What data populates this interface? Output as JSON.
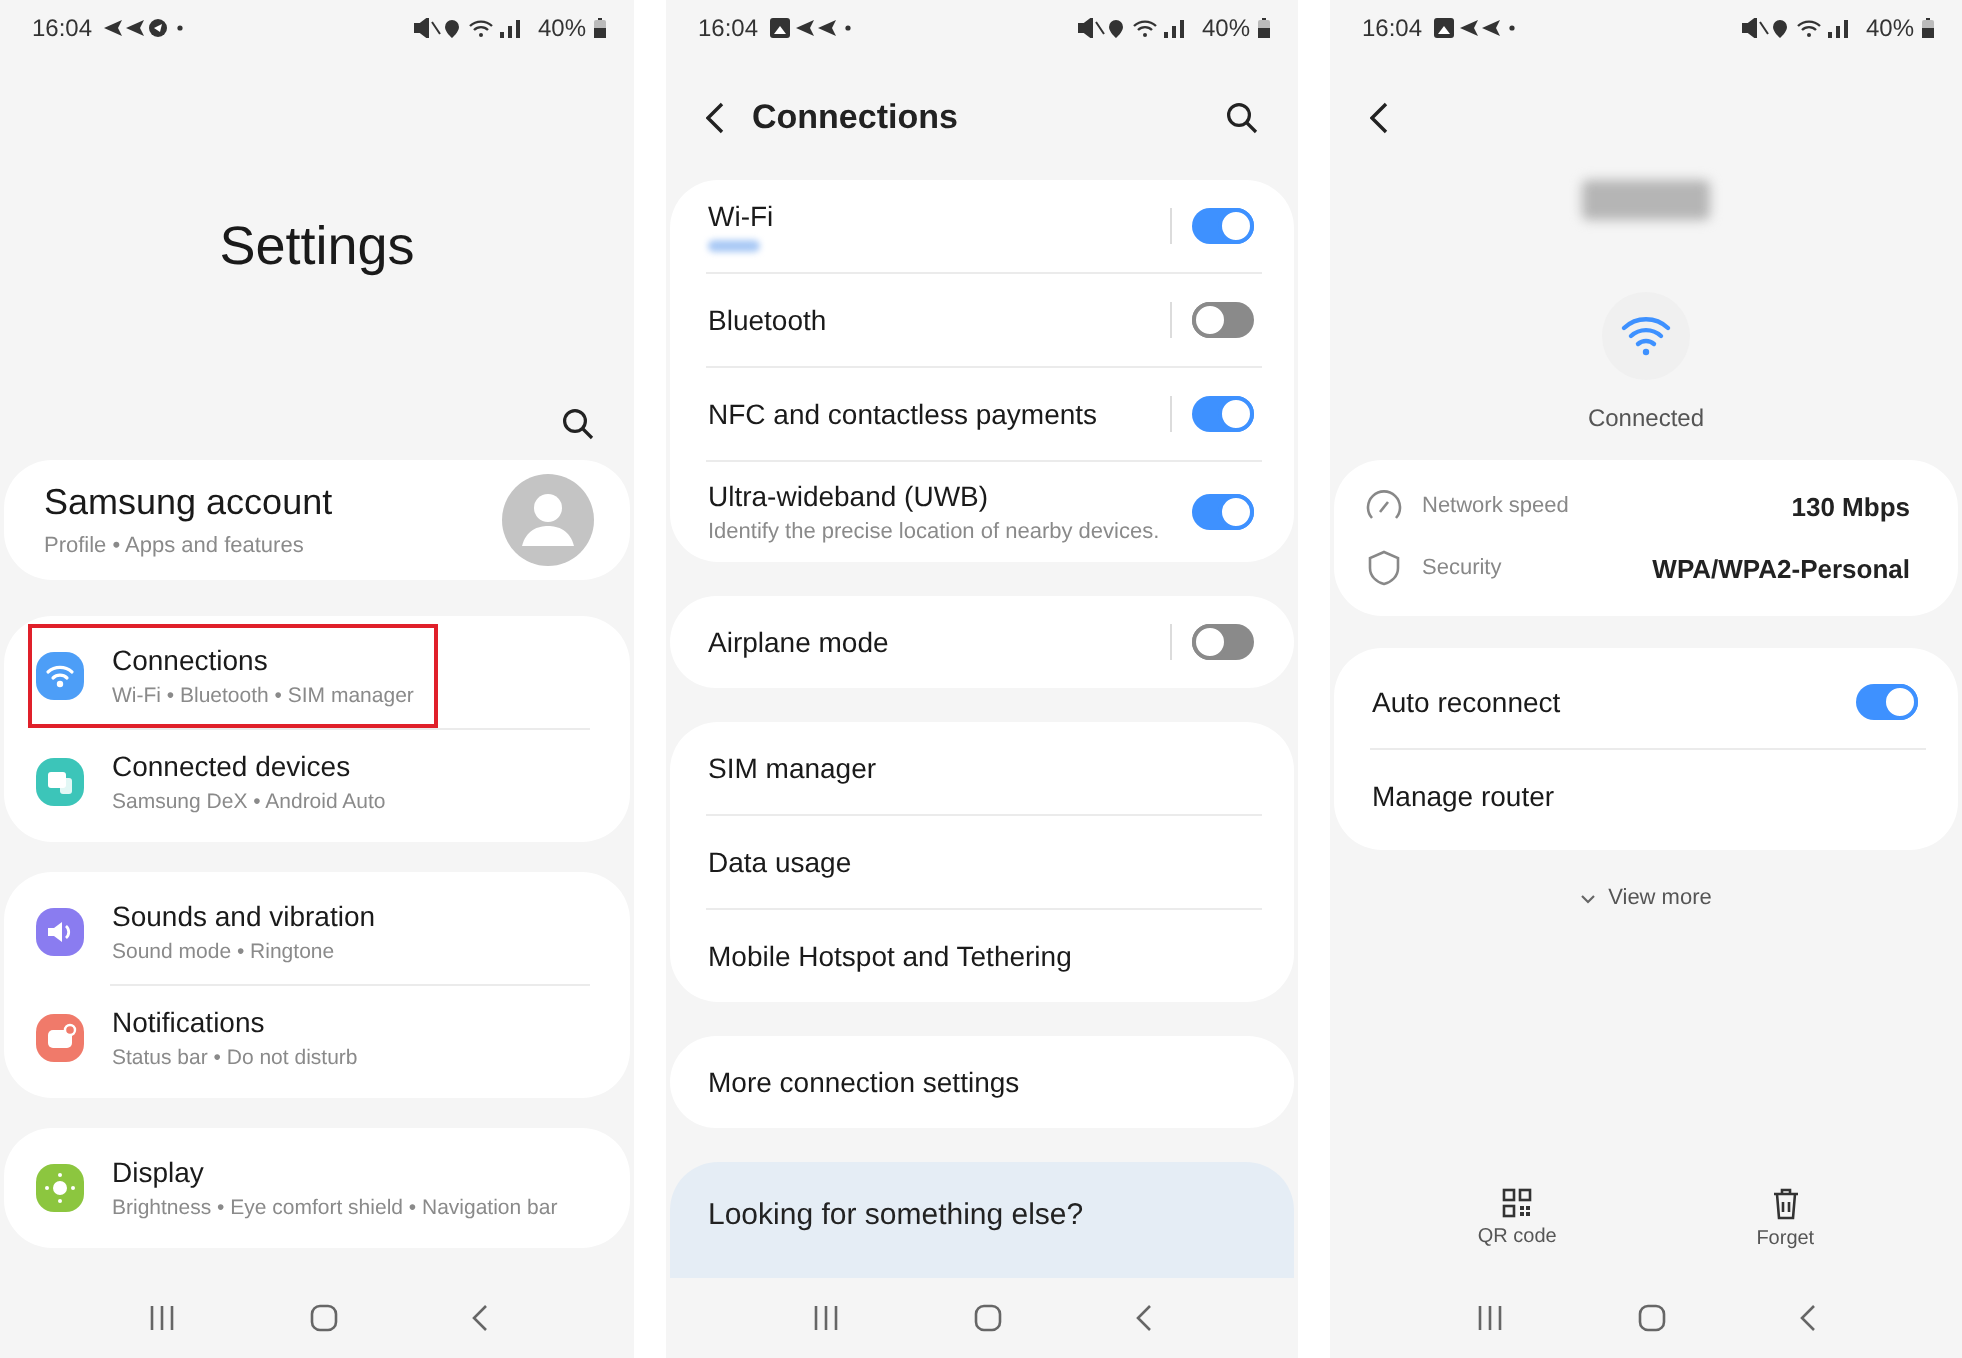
{
  "settings_screen": {
    "status_bar": {
      "time": "16:04",
      "battery": "40%"
    },
    "title": "Settings",
    "account": {
      "name": "Samsung account",
      "subtitle": "Profile  •  Apps and features"
    },
    "groups": [
      [
        {
          "kind": "wifi",
          "color": "#4d9ef7",
          "title": "Connections",
          "subtitle": "Wi-Fi  •  Bluetooth  •  SIM manager",
          "highlighted": true
        },
        {
          "kind": "devices",
          "color": "#3cc5b9",
          "title": "Connected devices",
          "subtitle": "Samsung DeX  •  Android Auto",
          "highlighted": false
        }
      ],
      [
        {
          "kind": "sound",
          "color": "#8a7cf0",
          "title": "Sounds and vibration",
          "subtitle": "Sound mode  •  Ringtone",
          "highlighted": false
        },
        {
          "kind": "notifications",
          "color": "#f07a6a",
          "title": "Notifications",
          "subtitle": "Status bar  •  Do not disturb",
          "highlighted": false
        }
      ],
      [
        {
          "kind": "display",
          "color": "#8cc63f",
          "title": "Display",
          "subtitle": "Brightness  •  Eye comfort shield  •  Navigation bar",
          "highlighted": false
        }
      ]
    ]
  },
  "connections_screen": {
    "status_bar": {
      "time": "16:04",
      "battery": "40%"
    },
    "title": "Connections",
    "groups": [
      [
        {
          "kind": "split-toggle",
          "title": "Wi-Fi",
          "redacted_subtitle": true,
          "on": true
        },
        {
          "kind": "split-toggle",
          "title": "Bluetooth",
          "on": false
        },
        {
          "kind": "split-toggle",
          "title": "NFC and contactless payments",
          "on": true
        },
        {
          "kind": "toggle",
          "title": "Ultra-wideband (UWB)",
          "subtitle": "Identify the precise location of nearby devices.",
          "on": true
        }
      ],
      [
        {
          "kind": "split-toggle",
          "title": "Airplane mode",
          "on": false
        }
      ],
      [
        {
          "kind": "link",
          "title": "SIM manager"
        },
        {
          "kind": "link",
          "title": "Data usage"
        },
        {
          "kind": "link",
          "title": "Mobile Hotspot and Tethering"
        }
      ],
      [
        {
          "kind": "link",
          "title": "More connection settings"
        }
      ]
    ],
    "suggestion": "Looking for something else?"
  },
  "wifi_detail_screen": {
    "status_bar": {
      "time": "16:04",
      "battery": "40%"
    },
    "status": "Connected",
    "info": [
      {
        "kind": "speed",
        "label": "Network speed",
        "value": "130 Mbps"
      },
      {
        "kind": "security",
        "label": "Security",
        "value": "WPA/WPA2-Personal"
      }
    ],
    "options": [
      {
        "kind": "toggle",
        "title": "Auto reconnect",
        "on": true
      },
      {
        "kind": "link",
        "title": "Manage router"
      }
    ],
    "view_more": "View more",
    "actions": [
      {
        "kind": "qr",
        "label": "QR code"
      },
      {
        "kind": "delete",
        "label": "Forget"
      }
    ]
  }
}
